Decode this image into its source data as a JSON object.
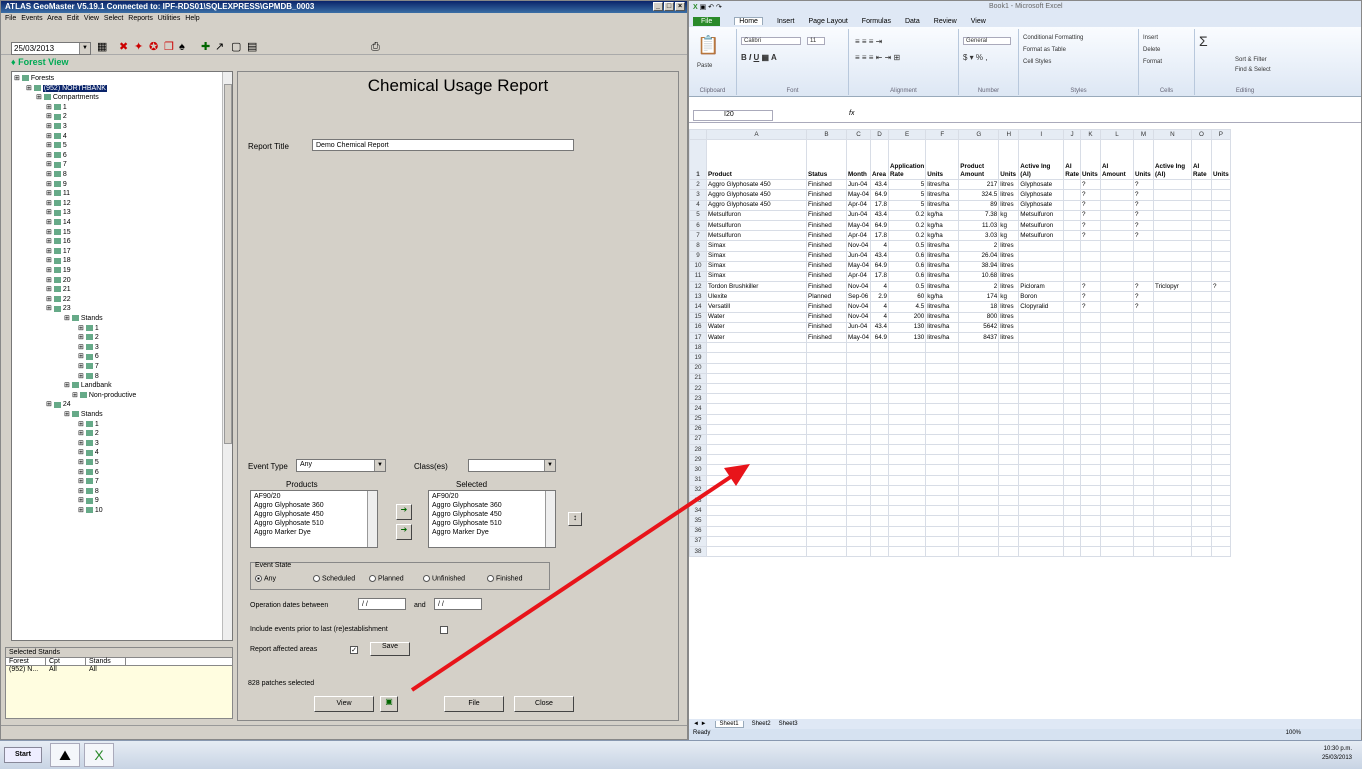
{
  "atlas": {
    "title": "ATLAS GeoMaster V5.19.1   Connected to: IPF-RDS01\\SQLEXPRESS\\GPMDB_0003",
    "menu": "File Events Area Edit View Select Reports Utilities Help",
    "date": "25/03/2013",
    "forest_view": "Forest View",
    "tree": {
      "root": "Forests",
      "forest": "(952) NORTHBANK",
      "compartments": "Compartments",
      "items": [
        "1",
        "2",
        "3",
        "4",
        "5",
        "6",
        "7",
        "8",
        "9",
        "11",
        "12",
        "13",
        "14",
        "15",
        "16",
        "17",
        "18",
        "19",
        "20",
        "21",
        "22",
        "23"
      ],
      "stands_label": "Stands",
      "stands_23": [
        "1",
        "2",
        "3",
        "6",
        "7",
        "8"
      ],
      "landbank": "Landbank",
      "nonproductive": "Non-productive",
      "comp_24": "24",
      "stands_24": [
        "1",
        "2",
        "3",
        "4",
        "5",
        "6",
        "7",
        "8",
        "9",
        "10"
      ]
    },
    "selected_stands": {
      "header": "Selected Stands",
      "cols": [
        "Forest",
        "Cpt",
        "Stands"
      ],
      "row": [
        "(952) N...",
        "All",
        "All"
      ]
    }
  },
  "report": {
    "heading": "Chemical Usage Report",
    "title_label": "Report Title",
    "title_value": "Demo Chemical Report",
    "event_type_label": "Event Type",
    "event_type_value": "Any",
    "class_label": "Class(es)",
    "products_label": "Products",
    "selected_label": "Selected",
    "products": [
      "AF90/20",
      "Aggro Glyphosate 360",
      "Aggro Glyphosate 450",
      "Aggro Glyphosate 510",
      "Aggro Marker Dye"
    ],
    "selected": [
      "AF90/20",
      "Aggro Glyphosate 360",
      "Aggro Glyphosate 450",
      "Aggro Glyphosate 510",
      "Aggro Marker Dye"
    ],
    "event_state_label": "Event State",
    "event_states": [
      "Any",
      "Scheduled",
      "Planned",
      "Unfinished",
      "Finished"
    ],
    "op_dates_label": "Operation dates between",
    "op_date_from": "/ /",
    "and_label": "and",
    "op_date_to": "/ /",
    "include_label": "Include events prior to last (re)establishment",
    "affected_label": "Report affected areas",
    "save_label": "Save",
    "patches_label": "828 patches selected",
    "view_label": "View",
    "file_label": "File",
    "close_label": "Close"
  },
  "excel": {
    "title": "Book1 - Microsoft Excel",
    "tabs": [
      "File",
      "Home",
      "Insert",
      "Page Layout",
      "Formulas",
      "Data",
      "Review",
      "View"
    ],
    "font_name": "Calibri",
    "font_size": "11",
    "number_format": "General",
    "ribbon": {
      "clipboard": "Clipboard",
      "font": "Font",
      "alignment": "Alignment",
      "number": "Number",
      "styles": "Styles",
      "cells": "Cells",
      "editing": "Editing",
      "cond_format": "Conditional Formatting",
      "format_table": "Format as Table",
      "cell_styles": "Cell Styles",
      "insert": "Insert",
      "delete": "Delete",
      "format": "Format",
      "sort": "Sort & Filter",
      "find": "Find & Select",
      "paste": "Paste"
    },
    "name_box": "I20",
    "fx": "fx",
    "columns": [
      "A",
      "B",
      "C",
      "D",
      "E",
      "F",
      "G",
      "H",
      "I",
      "J",
      "K",
      "L",
      "M",
      "N",
      "O",
      "P"
    ],
    "header_row": [
      "Product",
      "Status",
      "Month",
      "Area",
      "Application Rate",
      "Units",
      "Product Amount",
      "Units",
      "Active Ing (AI)",
      "AI Rate",
      "Units",
      "AI Amount",
      "Units",
      "Active Ing (AI)",
      "AI Rate",
      "Units"
    ],
    "rows": [
      [
        "Aggro Glyphosate 450",
        "Finished",
        "Jun-04",
        "43.4",
        "5",
        "litres/ha",
        "217",
        "litres",
        "Glyphosate",
        "",
        "?",
        "",
        "?",
        "",
        "",
        ""
      ],
      [
        "Aggro Glyphosate 450",
        "Finished",
        "May-04",
        "64.9",
        "5",
        "litres/ha",
        "324.5",
        "litres",
        "Glyphosate",
        "",
        "?",
        "",
        "?",
        "",
        "",
        ""
      ],
      [
        "Aggro Glyphosate 450",
        "Finished",
        "Apr-04",
        "17.8",
        "5",
        "litres/ha",
        "89",
        "litres",
        "Glyphosate",
        "",
        "?",
        "",
        "?",
        "",
        "",
        ""
      ],
      [
        "Metsulfuron",
        "Finished",
        "Jun-04",
        "43.4",
        "0.2",
        "kg/ha",
        "7.38",
        "kg",
        "Metsulfuron",
        "",
        "?",
        "",
        "?",
        "",
        "",
        ""
      ],
      [
        "Metsulfuron",
        "Finished",
        "May-04",
        "64.9",
        "0.2",
        "kg/ha",
        "11.03",
        "kg",
        "Metsulfuron",
        "",
        "?",
        "",
        "?",
        "",
        "",
        ""
      ],
      [
        "Metsulfuron",
        "Finished",
        "Apr-04",
        "17.8",
        "0.2",
        "kg/ha",
        "3.03",
        "kg",
        "Metsulfuron",
        "",
        "?",
        "",
        "?",
        "",
        "",
        ""
      ],
      [
        "Simax",
        "Finished",
        "Nov-04",
        "4",
        "0.5",
        "litres/ha",
        "2",
        "litres",
        "",
        "",
        "",
        "",
        "",
        "",
        "",
        ""
      ],
      [
        "Simax",
        "Finished",
        "Jun-04",
        "43.4",
        "0.6",
        "litres/ha",
        "26.04",
        "litres",
        "",
        "",
        "",
        "",
        "",
        "",
        "",
        ""
      ],
      [
        "Simax",
        "Finished",
        "May-04",
        "64.9",
        "0.6",
        "litres/ha",
        "38.94",
        "litres",
        "",
        "",
        "",
        "",
        "",
        "",
        "",
        ""
      ],
      [
        "Simax",
        "Finished",
        "Apr-04",
        "17.8",
        "0.6",
        "litres/ha",
        "10.68",
        "litres",
        "",
        "",
        "",
        "",
        "",
        "",
        "",
        ""
      ],
      [
        "Tordon Brushkiller",
        "Finished",
        "Nov-04",
        "4",
        "0.5",
        "litres/ha",
        "2",
        "litres",
        "Picloram",
        "",
        "?",
        "",
        "?",
        "Triclopyr",
        "",
        "?"
      ],
      [
        "Ulexite",
        "Planned",
        "Sep-06",
        "2.9",
        "60",
        "kg/ha",
        "174",
        "kg",
        "Boron",
        "",
        "?",
        "",
        "?",
        "",
        "",
        ""
      ],
      [
        "Versatill",
        "Finished",
        "Nov-04",
        "4",
        "4.5",
        "litres/ha",
        "18",
        "litres",
        "Clopyralid",
        "",
        "?",
        "",
        "?",
        "",
        "",
        ""
      ],
      [
        "Water",
        "Finished",
        "Nov-04",
        "4",
        "200",
        "litres/ha",
        "800",
        "litres",
        "",
        "",
        "",
        "",
        "",
        "",
        "",
        ""
      ],
      [
        "Water",
        "Finished",
        "Jun-04",
        "43.4",
        "130",
        "litres/ha",
        "5642",
        "litres",
        "",
        "",
        "",
        "",
        "",
        "",
        "",
        ""
      ],
      [
        "Water",
        "Finished",
        "May-04",
        "64.9",
        "130",
        "litres/ha",
        "8437",
        "litres",
        "",
        "",
        "",
        "",
        "",
        "",
        "",
        ""
      ]
    ],
    "empty_rows_to": 38,
    "sheets": [
      "Sheet1",
      "Sheet2",
      "Sheet3"
    ],
    "status": "Ready",
    "zoom": "100%"
  },
  "taskbar": {
    "start": "Start",
    "time": "10:30 p.m.",
    "date": "25/03/2013"
  },
  "colors": {
    "arrow": "#e8141a",
    "title_bar": "#0a246a",
    "excel_file_tab": "#2a8a2a"
  }
}
